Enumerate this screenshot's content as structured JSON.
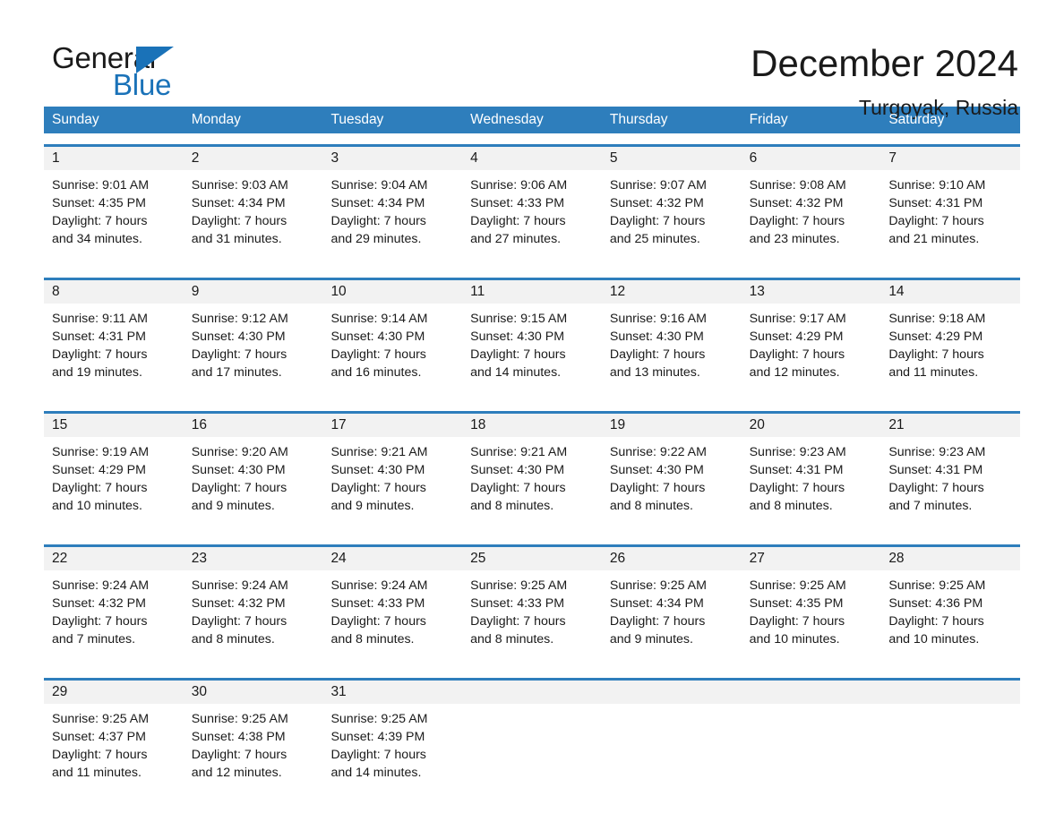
{
  "brand": {
    "name_top": "General",
    "name_bottom": "Blue",
    "accent_color": "#1a72b8"
  },
  "header": {
    "title": "December 2024",
    "location": "Turgoyak, Russia"
  },
  "calendar": {
    "header_color": "#2e7ebc",
    "daynum_band_color": "#f2f2f2",
    "weekdays": [
      "Sunday",
      "Monday",
      "Tuesday",
      "Wednesday",
      "Thursday",
      "Friday",
      "Saturday"
    ],
    "weeks": [
      [
        {
          "day": "1",
          "sunrise": "Sunrise: 9:01 AM",
          "sunset": "Sunset: 4:35 PM",
          "daylight_1": "Daylight: 7 hours",
          "daylight_2": "and 34 minutes."
        },
        {
          "day": "2",
          "sunrise": "Sunrise: 9:03 AM",
          "sunset": "Sunset: 4:34 PM",
          "daylight_1": "Daylight: 7 hours",
          "daylight_2": "and 31 minutes."
        },
        {
          "day": "3",
          "sunrise": "Sunrise: 9:04 AM",
          "sunset": "Sunset: 4:34 PM",
          "daylight_1": "Daylight: 7 hours",
          "daylight_2": "and 29 minutes."
        },
        {
          "day": "4",
          "sunrise": "Sunrise: 9:06 AM",
          "sunset": "Sunset: 4:33 PM",
          "daylight_1": "Daylight: 7 hours",
          "daylight_2": "and 27 minutes."
        },
        {
          "day": "5",
          "sunrise": "Sunrise: 9:07 AM",
          "sunset": "Sunset: 4:32 PM",
          "daylight_1": "Daylight: 7 hours",
          "daylight_2": "and 25 minutes."
        },
        {
          "day": "6",
          "sunrise": "Sunrise: 9:08 AM",
          "sunset": "Sunset: 4:32 PM",
          "daylight_1": "Daylight: 7 hours",
          "daylight_2": "and 23 minutes."
        },
        {
          "day": "7",
          "sunrise": "Sunrise: 9:10 AM",
          "sunset": "Sunset: 4:31 PM",
          "daylight_1": "Daylight: 7 hours",
          "daylight_2": "and 21 minutes."
        }
      ],
      [
        {
          "day": "8",
          "sunrise": "Sunrise: 9:11 AM",
          "sunset": "Sunset: 4:31 PM",
          "daylight_1": "Daylight: 7 hours",
          "daylight_2": "and 19 minutes."
        },
        {
          "day": "9",
          "sunrise": "Sunrise: 9:12 AM",
          "sunset": "Sunset: 4:30 PM",
          "daylight_1": "Daylight: 7 hours",
          "daylight_2": "and 17 minutes."
        },
        {
          "day": "10",
          "sunrise": "Sunrise: 9:14 AM",
          "sunset": "Sunset: 4:30 PM",
          "daylight_1": "Daylight: 7 hours",
          "daylight_2": "and 16 minutes."
        },
        {
          "day": "11",
          "sunrise": "Sunrise: 9:15 AM",
          "sunset": "Sunset: 4:30 PM",
          "daylight_1": "Daylight: 7 hours",
          "daylight_2": "and 14 minutes."
        },
        {
          "day": "12",
          "sunrise": "Sunrise: 9:16 AM",
          "sunset": "Sunset: 4:30 PM",
          "daylight_1": "Daylight: 7 hours",
          "daylight_2": "and 13 minutes."
        },
        {
          "day": "13",
          "sunrise": "Sunrise: 9:17 AM",
          "sunset": "Sunset: 4:29 PM",
          "daylight_1": "Daylight: 7 hours",
          "daylight_2": "and 12 minutes."
        },
        {
          "day": "14",
          "sunrise": "Sunrise: 9:18 AM",
          "sunset": "Sunset: 4:29 PM",
          "daylight_1": "Daylight: 7 hours",
          "daylight_2": "and 11 minutes."
        }
      ],
      [
        {
          "day": "15",
          "sunrise": "Sunrise: 9:19 AM",
          "sunset": "Sunset: 4:29 PM",
          "daylight_1": "Daylight: 7 hours",
          "daylight_2": "and 10 minutes."
        },
        {
          "day": "16",
          "sunrise": "Sunrise: 9:20 AM",
          "sunset": "Sunset: 4:30 PM",
          "daylight_1": "Daylight: 7 hours",
          "daylight_2": "and 9 minutes."
        },
        {
          "day": "17",
          "sunrise": "Sunrise: 9:21 AM",
          "sunset": "Sunset: 4:30 PM",
          "daylight_1": "Daylight: 7 hours",
          "daylight_2": "and 9 minutes."
        },
        {
          "day": "18",
          "sunrise": "Sunrise: 9:21 AM",
          "sunset": "Sunset: 4:30 PM",
          "daylight_1": "Daylight: 7 hours",
          "daylight_2": "and 8 minutes."
        },
        {
          "day": "19",
          "sunrise": "Sunrise: 9:22 AM",
          "sunset": "Sunset: 4:30 PM",
          "daylight_1": "Daylight: 7 hours",
          "daylight_2": "and 8 minutes."
        },
        {
          "day": "20",
          "sunrise": "Sunrise: 9:23 AM",
          "sunset": "Sunset: 4:31 PM",
          "daylight_1": "Daylight: 7 hours",
          "daylight_2": "and 8 minutes."
        },
        {
          "day": "21",
          "sunrise": "Sunrise: 9:23 AM",
          "sunset": "Sunset: 4:31 PM",
          "daylight_1": "Daylight: 7 hours",
          "daylight_2": "and 7 minutes."
        }
      ],
      [
        {
          "day": "22",
          "sunrise": "Sunrise: 9:24 AM",
          "sunset": "Sunset: 4:32 PM",
          "daylight_1": "Daylight: 7 hours",
          "daylight_2": "and 7 minutes."
        },
        {
          "day": "23",
          "sunrise": "Sunrise: 9:24 AM",
          "sunset": "Sunset: 4:32 PM",
          "daylight_1": "Daylight: 7 hours",
          "daylight_2": "and 8 minutes."
        },
        {
          "day": "24",
          "sunrise": "Sunrise: 9:24 AM",
          "sunset": "Sunset: 4:33 PM",
          "daylight_1": "Daylight: 7 hours",
          "daylight_2": "and 8 minutes."
        },
        {
          "day": "25",
          "sunrise": "Sunrise: 9:25 AM",
          "sunset": "Sunset: 4:33 PM",
          "daylight_1": "Daylight: 7 hours",
          "daylight_2": "and 8 minutes."
        },
        {
          "day": "26",
          "sunrise": "Sunrise: 9:25 AM",
          "sunset": "Sunset: 4:34 PM",
          "daylight_1": "Daylight: 7 hours",
          "daylight_2": "and 9 minutes."
        },
        {
          "day": "27",
          "sunrise": "Sunrise: 9:25 AM",
          "sunset": "Sunset: 4:35 PM",
          "daylight_1": "Daylight: 7 hours",
          "daylight_2": "and 10 minutes."
        },
        {
          "day": "28",
          "sunrise": "Sunrise: 9:25 AM",
          "sunset": "Sunset: 4:36 PM",
          "daylight_1": "Daylight: 7 hours",
          "daylight_2": "and 10 minutes."
        }
      ],
      [
        {
          "day": "29",
          "sunrise": "Sunrise: 9:25 AM",
          "sunset": "Sunset: 4:37 PM",
          "daylight_1": "Daylight: 7 hours",
          "daylight_2": "and 11 minutes."
        },
        {
          "day": "30",
          "sunrise": "Sunrise: 9:25 AM",
          "sunset": "Sunset: 4:38 PM",
          "daylight_1": "Daylight: 7 hours",
          "daylight_2": "and 12 minutes."
        },
        {
          "day": "31",
          "sunrise": "Sunrise: 9:25 AM",
          "sunset": "Sunset: 4:39 PM",
          "daylight_1": "Daylight: 7 hours",
          "daylight_2": "and 14 minutes."
        },
        {
          "day": "",
          "sunrise": "",
          "sunset": "",
          "daylight_1": "",
          "daylight_2": ""
        },
        {
          "day": "",
          "sunrise": "",
          "sunset": "",
          "daylight_1": "",
          "daylight_2": ""
        },
        {
          "day": "",
          "sunrise": "",
          "sunset": "",
          "daylight_1": "",
          "daylight_2": ""
        },
        {
          "day": "",
          "sunrise": "",
          "sunset": "",
          "daylight_1": "",
          "daylight_2": ""
        }
      ]
    ]
  }
}
